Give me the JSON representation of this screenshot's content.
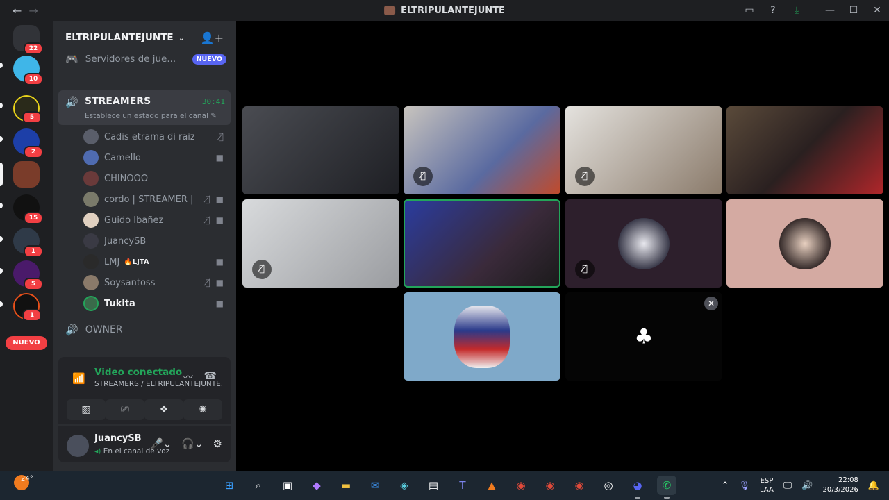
{
  "window": {
    "title": "ELTRIPULANTEJUNTE"
  },
  "rail": {
    "badges": [
      "22",
      "10",
      "5",
      "2",
      "15",
      "1",
      "5",
      "1"
    ],
    "nuevo_label": "NUEVO"
  },
  "guild": {
    "name": "ELTRIPULANTEJUNTE"
  },
  "promo": {
    "label": "Servidores de jue...",
    "badge": "NUEVO"
  },
  "voice_channel": {
    "name": "STREAMERS",
    "timer": "30:41",
    "status_placeholder": "Establece un estado para el canal"
  },
  "members": [
    {
      "name": "Cadis etrama di raizel",
      "tag": "",
      "bold": false,
      "muted": true,
      "video": false
    },
    {
      "name": "Camello",
      "tag": "",
      "bold": false,
      "muted": false,
      "video": true
    },
    {
      "name": "CHINOOO",
      "tag": "",
      "bold": false,
      "muted": false,
      "video": false
    },
    {
      "name": "cordo | STREAMER | ...",
      "tag": "",
      "bold": false,
      "muted": true,
      "video": true
    },
    {
      "name": "Guido Ibañez",
      "tag": "",
      "bold": false,
      "muted": true,
      "video": true
    },
    {
      "name": "JuancySB",
      "tag": "",
      "bold": false,
      "muted": false,
      "video": false
    },
    {
      "name": "LMJ",
      "tag": "LJTA",
      "bold": false,
      "muted": false,
      "video": true
    },
    {
      "name": "Soysantoss",
      "tag": "",
      "bold": false,
      "muted": true,
      "video": true
    },
    {
      "name": "Tukita",
      "tag": "",
      "bold": true,
      "muted": false,
      "video": true
    }
  ],
  "owner_channel": {
    "name": "OWNER"
  },
  "voice_panel": {
    "status": "Video conectado",
    "location": "STREAMERS / ELTRIPULANTEJUNTE..."
  },
  "user": {
    "name": "JuancySB",
    "status": "En el canal de voz"
  },
  "taskbar": {
    "temperature": "24°",
    "lang_top": "ESP",
    "lang_bottom": "LAA",
    "time": "22:08",
    "date": "20/3/2026"
  },
  "colors": {
    "accent_green": "#23a55a",
    "danger_red": "#f23f43",
    "blurple": "#5865f2"
  }
}
